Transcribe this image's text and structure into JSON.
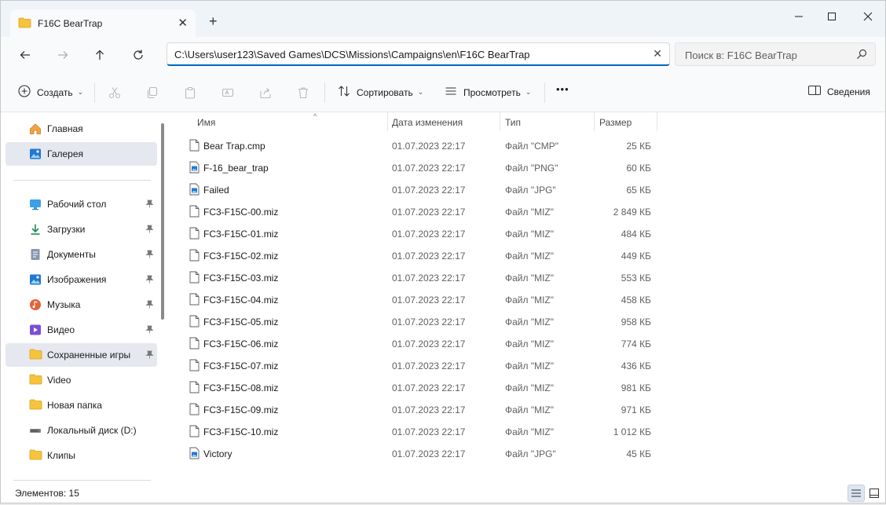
{
  "window": {
    "tab_title": "F16C BearTrap",
    "new_tab_label": "+"
  },
  "nav": {
    "address": "C:\\Users\\user123\\Saved Games\\DCS\\Missions\\Campaigns\\en\\F16C BearTrap",
    "search_placeholder": "Поиск в: F16C BearTrap"
  },
  "toolbar": {
    "create_label": "Создать",
    "sort_label": "Сортировать",
    "view_label": "Просмотреть",
    "more_label": "•••",
    "details_label": "Сведения"
  },
  "sidebar": {
    "top_items": [
      {
        "label": "Главная",
        "icon": "home-icon"
      },
      {
        "label": "Галерея",
        "icon": "gallery-icon"
      }
    ],
    "pinned_items": [
      {
        "label": "Рабочий стол",
        "icon": "desktop-icon"
      },
      {
        "label": "Загрузки",
        "icon": "downloads-icon"
      },
      {
        "label": "Документы",
        "icon": "documents-icon"
      },
      {
        "label": "Изображения",
        "icon": "pictures-icon"
      },
      {
        "label": "Музыка",
        "icon": "music-icon"
      },
      {
        "label": "Видео",
        "icon": "video-icon"
      },
      {
        "label": "Сохраненные игры",
        "icon": "folder-icon"
      }
    ],
    "other_items": [
      {
        "label": "Video",
        "icon": "folder-icon"
      },
      {
        "label": "Новая папка",
        "icon": "folder-icon"
      },
      {
        "label": "Локальный диск (D:)",
        "icon": "drive-icon"
      },
      {
        "label": "Клипы",
        "icon": "folder-icon"
      }
    ]
  },
  "columns": {
    "name": "Имя",
    "date": "Дата изменения",
    "type": "Тип",
    "size": "Размер"
  },
  "files": [
    {
      "name": "Bear Trap.cmp",
      "date": "01.07.2023 22:17",
      "type": "Файл \"CMP\"",
      "size": "25 КБ",
      "icon": "file-icon"
    },
    {
      "name": "F-16_bear_trap",
      "date": "01.07.2023 22:17",
      "type": "Файл \"PNG\"",
      "size": "60 КБ",
      "icon": "image-file-icon"
    },
    {
      "name": "Failed",
      "date": "01.07.2023 22:17",
      "type": "Файл \"JPG\"",
      "size": "65 КБ",
      "icon": "image-file-icon"
    },
    {
      "name": "FC3-F15C-00.miz",
      "date": "01.07.2023 22:17",
      "type": "Файл \"MIZ\"",
      "size": "2 849 КБ",
      "icon": "file-icon"
    },
    {
      "name": "FC3-F15C-01.miz",
      "date": "01.07.2023 22:17",
      "type": "Файл \"MIZ\"",
      "size": "484 КБ",
      "icon": "file-icon"
    },
    {
      "name": "FC3-F15C-02.miz",
      "date": "01.07.2023 22:17",
      "type": "Файл \"MIZ\"",
      "size": "449 КБ",
      "icon": "file-icon"
    },
    {
      "name": "FC3-F15C-03.miz",
      "date": "01.07.2023 22:17",
      "type": "Файл \"MIZ\"",
      "size": "553 КБ",
      "icon": "file-icon"
    },
    {
      "name": "FC3-F15C-04.miz",
      "date": "01.07.2023 22:17",
      "type": "Файл \"MIZ\"",
      "size": "458 КБ",
      "icon": "file-icon"
    },
    {
      "name": "FC3-F15C-05.miz",
      "date": "01.07.2023 22:17",
      "type": "Файл \"MIZ\"",
      "size": "958 КБ",
      "icon": "file-icon"
    },
    {
      "name": "FC3-F15C-06.miz",
      "date": "01.07.2023 22:17",
      "type": "Файл \"MIZ\"",
      "size": "774 КБ",
      "icon": "file-icon"
    },
    {
      "name": "FC3-F15C-07.miz",
      "date": "01.07.2023 22:17",
      "type": "Файл \"MIZ\"",
      "size": "436 КБ",
      "icon": "file-icon"
    },
    {
      "name": "FC3-F15C-08.miz",
      "date": "01.07.2023 22:17",
      "type": "Файл \"MIZ\"",
      "size": "981 КБ",
      "icon": "file-icon"
    },
    {
      "name": "FC3-F15C-09.miz",
      "date": "01.07.2023 22:17",
      "type": "Файл \"MIZ\"",
      "size": "971 КБ",
      "icon": "file-icon"
    },
    {
      "name": "FC3-F15C-10.miz",
      "date": "01.07.2023 22:17",
      "type": "Файл \"MIZ\"",
      "size": "1 012 КБ",
      "icon": "file-icon"
    },
    {
      "name": "Victory",
      "date": "01.07.2023 22:17",
      "type": "Файл \"JPG\"",
      "size": "45 КБ",
      "icon": "image-file-icon"
    }
  ],
  "status": {
    "items_count": "Элементов: 15"
  },
  "colors": {
    "accent": "#0067c0",
    "folder": "#f8c33c",
    "selected_bg": "#e5e8ee"
  }
}
